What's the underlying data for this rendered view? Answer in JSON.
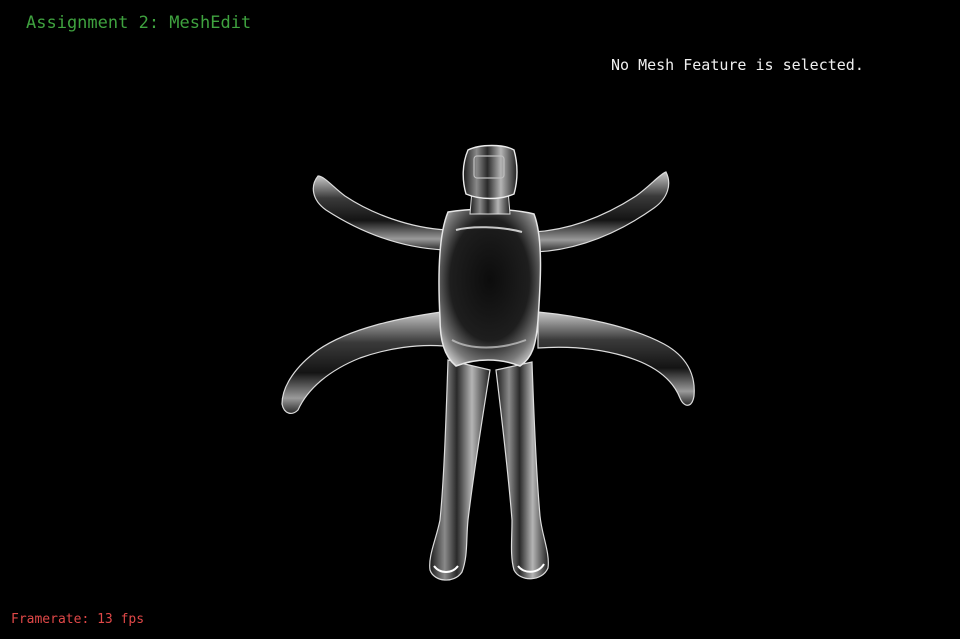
{
  "app": {
    "title": "Assignment 2: MeshEdit",
    "title_color": "#3fa23f"
  },
  "status": {
    "message": "No Mesh Feature is selected."
  },
  "footer": {
    "framerate_text": "Framerate: 13 fps",
    "framerate_color": "#e04848"
  },
  "scene": {
    "background": "#000000",
    "model": "six-limbed-figure-mesh",
    "material": "chrome"
  }
}
